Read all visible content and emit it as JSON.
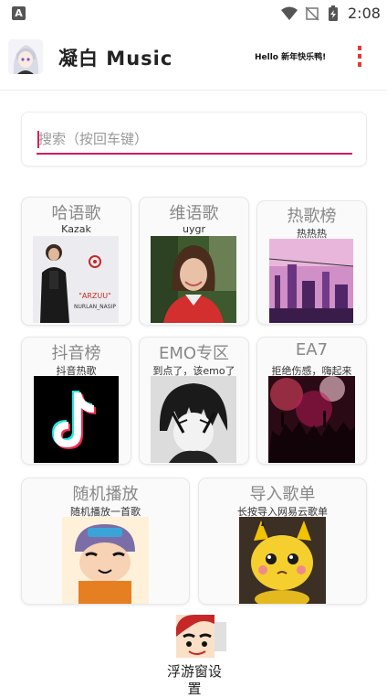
{
  "status_bar": {
    "time": "2:08",
    "app_icon": "A",
    "icons": [
      "wifi-icon",
      "no-signal-icon",
      "battery-charging-icon"
    ]
  },
  "header": {
    "title": "凝白 Music",
    "greeting": "Hello 新年快乐鸭!",
    "menu_icon": "more-vert-icon"
  },
  "search": {
    "placeholder": "搜索（按回车键）",
    "value": "",
    "accent_color": "#d81b60"
  },
  "cards": [
    {
      "title": "哈语歌",
      "subtitle": "Kazak"
    },
    {
      "title": "维语歌",
      "subtitle": "uygr"
    },
    {
      "title": "热歌榜",
      "subtitle": "热热热"
    },
    {
      "title": "抖音榜",
      "subtitle": "抖音热歌"
    },
    {
      "title": "EMO专区",
      "subtitle": "到点了，该emo了"
    },
    {
      "title": "EA7",
      "subtitle": "拒绝伤感，嗨起来"
    },
    {
      "title": "随机播放",
      "subtitle": "随机播放一首歌"
    },
    {
      "title": "导入歌单",
      "subtitle": "长按导入网易云歌单"
    }
  ],
  "album_art_text": {
    "kazak_name": "\"ARZUU\"",
    "kazak_artist": "NURLAN_NASIP"
  },
  "floating_window": {
    "label": "浮游窗设置"
  },
  "colors": {
    "accent": "#d81b60",
    "menu": "#e53935",
    "card_title": "#888888"
  }
}
